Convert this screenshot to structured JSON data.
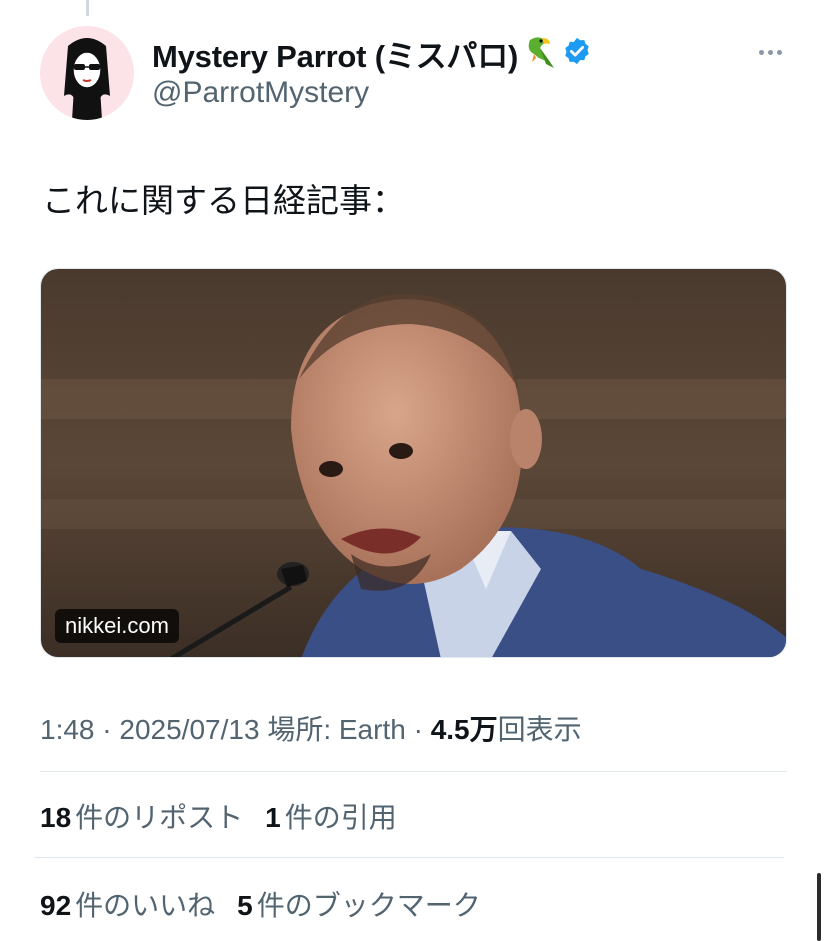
{
  "author": {
    "display_name": "Mystery Parrot (ミスパロ)",
    "emoji": "parrot-icon",
    "verified": true,
    "handle": "@ParrotMystery"
  },
  "tweet": {
    "text": "これに関する日経記事："
  },
  "media": {
    "source": "nikkei.com"
  },
  "meta": {
    "time": "1:48",
    "date": "2025/07/13",
    "location_label": "場所: Earth",
    "views_count": "4.5万",
    "views_label": "回表示"
  },
  "stats": {
    "reposts_count": "18",
    "reposts_label": "件のリポスト",
    "quotes_count": "1",
    "quotes_label": "件の引用",
    "likes_count": "92",
    "likes_label": "件のいいね",
    "bookmarks_count": "5",
    "bookmarks_label": "件のブックマーク"
  },
  "colors": {
    "verified": "#1d9bf0",
    "secondary_text": "#536471",
    "primary_text": "#0f1419"
  }
}
